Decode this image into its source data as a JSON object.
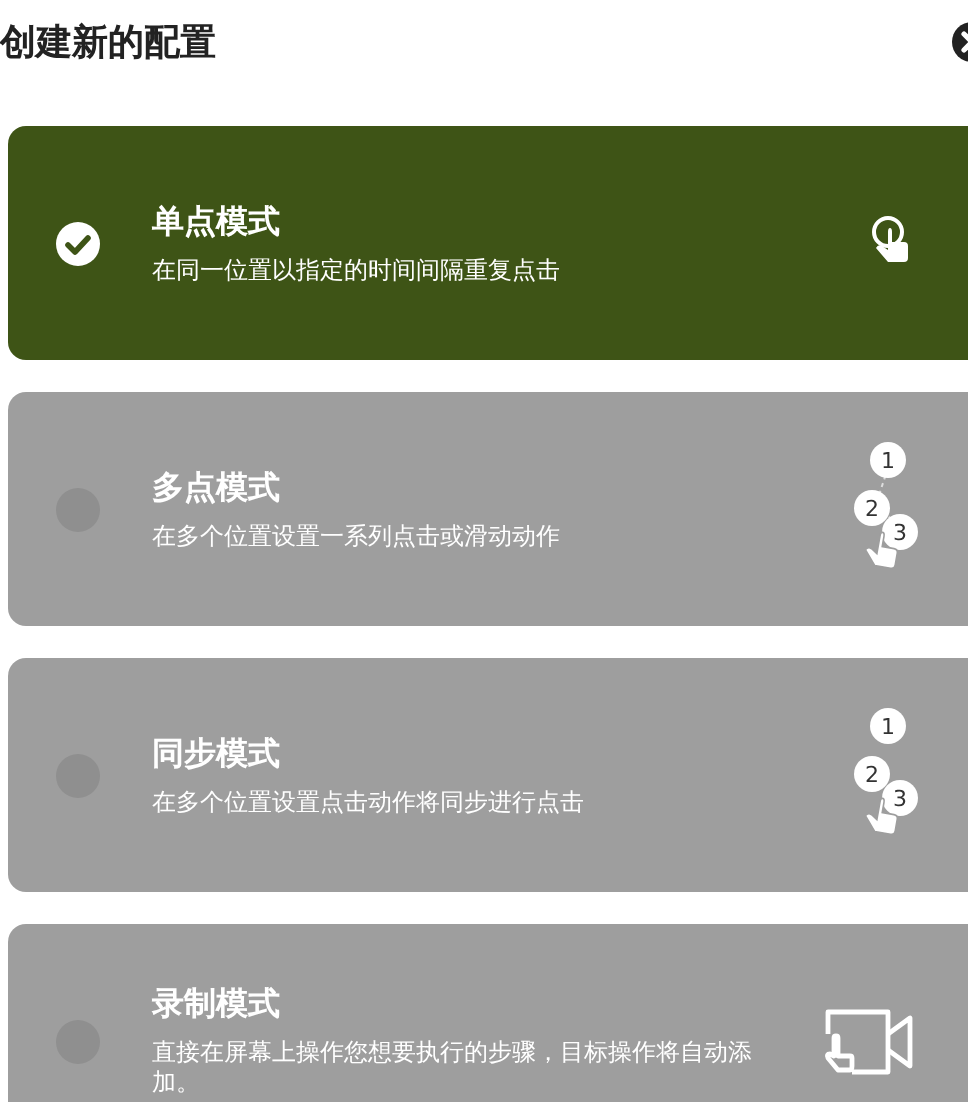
{
  "header": {
    "title": "创建新的配置"
  },
  "modes": [
    {
      "kind": "single",
      "title": "单点模式",
      "description": "在同一位置以指定的时间间隔重复点击",
      "selected": true
    },
    {
      "kind": "multi",
      "title": "多点模式",
      "description": "在多个位置设置一系列点击或滑动动作",
      "selected": false,
      "steps": [
        "1",
        "2",
        "3"
      ]
    },
    {
      "kind": "sync",
      "title": "同步模式",
      "description": "在多个位置设置点击动作将同步进行点击",
      "selected": false,
      "steps": [
        "1",
        "2",
        "3"
      ]
    },
    {
      "kind": "record",
      "title": "录制模式",
      "description": "直接在屏幕上操作您想要执行的步骤，目标操作将自动添加。",
      "selected": false
    }
  ]
}
